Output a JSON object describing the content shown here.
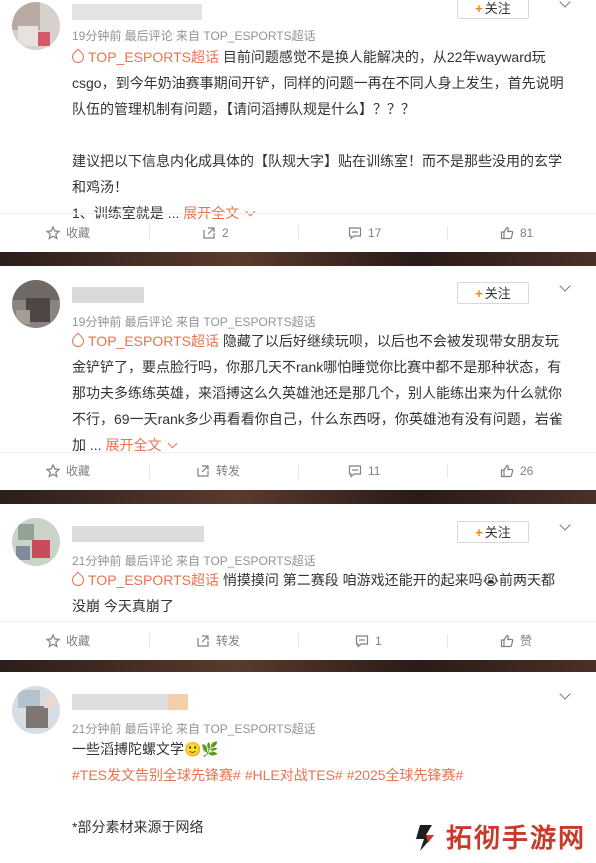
{
  "colors": {
    "accent": "#eb7350",
    "follow_plus": "#ff8200",
    "meta": "#939393",
    "watermark": "#c83a2a"
  },
  "posts": [
    {
      "meta": "19分钟前  最后评论  来自 TOP_ESPORTS超话",
      "follow": "关注",
      "topic": "TOP_ESPORTS超话",
      "text_line1": " 目前问题感觉不是换人能解决的，从22年wayward玩",
      "text_lines": [
        "csgo，到今年奶油赛事期间开铲，同样的问题一再在不同人身上发生，首先说明",
        "队伍的管理机制有问题，【请问滔搏队规是什么】？？？",
        "",
        "建议把以下信息内化成具体的【队规大字】贴在训练室！而不是那些没用的玄学",
        "和鸡汤！",
        "1、训练室就是 ... "
      ],
      "expand": "展开全文",
      "actions": {
        "fav": "收藏",
        "repost": "2",
        "comment": "17",
        "like": "81"
      }
    },
    {
      "meta": "19分钟前  最后评论  来自 TOP_ESPORTS超话",
      "follow": "关注",
      "topic": "TOP_ESPORTS超话",
      "text_line1": " 隐藏了以后好继续玩呗，以后也不会被发现带女朋友玩",
      "text_lines": [
        "金铲铲了，要点脸行吗，你那几天不rank哪怕睡觉你比赛中都不是那种状态，有",
        "那功夫多练练英雄，来滔搏这么久英雄池还是那几个，别人能练出来为什么就你",
        "不行，69一天rank多少再看看你自己，什么东西呀，你英雄池有没有问题，岩雀",
        "加 ... "
      ],
      "expand": "展开全文",
      "actions": {
        "fav": "收藏",
        "repost": "转发",
        "comment": "11",
        "like": "26"
      }
    },
    {
      "meta": "21分钟前  最后评论  来自 TOP_ESPORTS超话",
      "follow": "关注",
      "topic": "TOP_ESPORTS超话",
      "text_line1": " 悄摸摸问 第二赛段 咱游戏还能开的起来吗😭前两天都",
      "text_lines": [
        "没崩 今天真崩了"
      ],
      "actions": {
        "fav": "收藏",
        "repost": "转发",
        "comment": "1",
        "like": "赞"
      }
    },
    {
      "meta": "21分钟前  最后评论  来自 TOP_ESPORTS超话",
      "line1": "一些滔搏陀螺文学🙂🌿",
      "tags": "#TES发文告别全球先锋赛# #HLE对战TES# #2025全球先锋赛#",
      "note": "*部分素材来源于网络"
    }
  ],
  "watermark": "拓彻手游网"
}
